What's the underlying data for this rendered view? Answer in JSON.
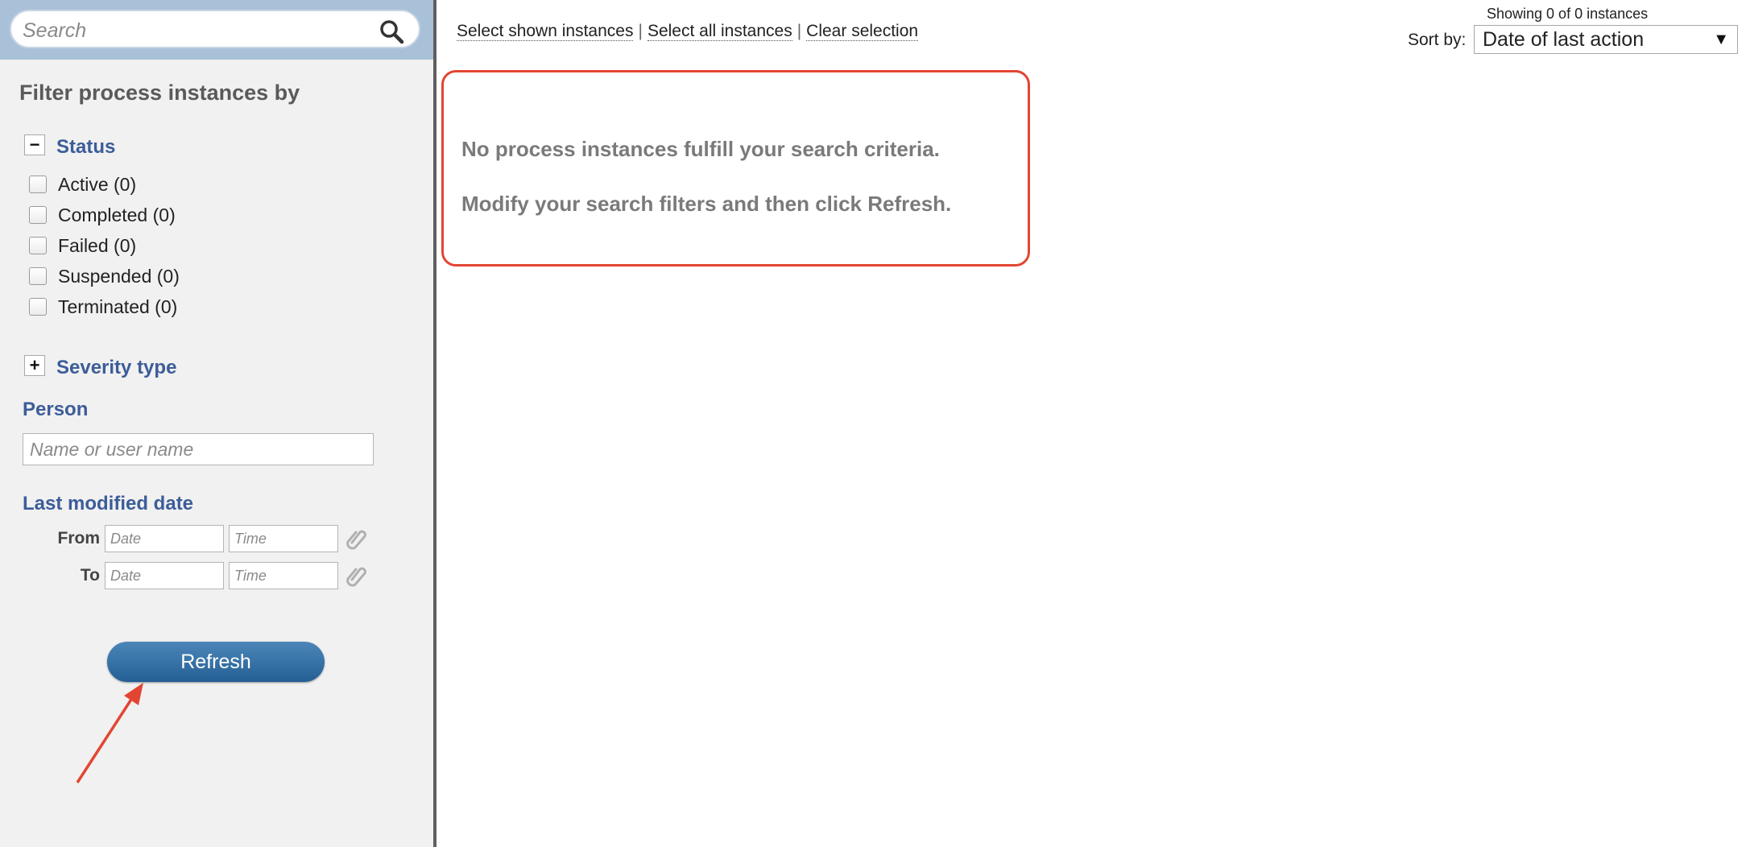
{
  "search": {
    "placeholder": "Search"
  },
  "sidebar": {
    "filter_title": "Filter process instances by",
    "status": {
      "label": "Status",
      "toggle": "−",
      "items": [
        {
          "label": "Active (0)"
        },
        {
          "label": "Completed (0)"
        },
        {
          "label": "Failed (0)"
        },
        {
          "label": "Suspended (0)"
        },
        {
          "label": "Terminated (0)"
        }
      ]
    },
    "severity": {
      "label": "Severity type",
      "toggle": "+"
    },
    "person": {
      "label": "Person",
      "placeholder": "Name or user name"
    },
    "last_modified": {
      "label": "Last modified date",
      "from_label": "From",
      "to_label": "To",
      "date_placeholder": "Date",
      "time_placeholder": "Time"
    },
    "refresh_label": "Refresh"
  },
  "main": {
    "links": {
      "select_shown": "Select shown instances",
      "select_all": "Select all instances",
      "clear": "Clear selection",
      "separator": "|"
    },
    "showing": "Showing 0 of 0 instances",
    "sort_label": "Sort by:",
    "sort_value": "Date of last action",
    "empty_line1": "No process instances fulfill your search criteria.",
    "empty_line2": "Modify your search filters and then click Refresh."
  },
  "icons": {
    "search": "search-icon",
    "attach": "paperclip-icon",
    "caret": "caret-down-icon"
  },
  "colors": {
    "accent": "#3c5d99",
    "button": "#2f6ea4",
    "annotation": "#e24632",
    "search_band": "#a9c1d8"
  }
}
